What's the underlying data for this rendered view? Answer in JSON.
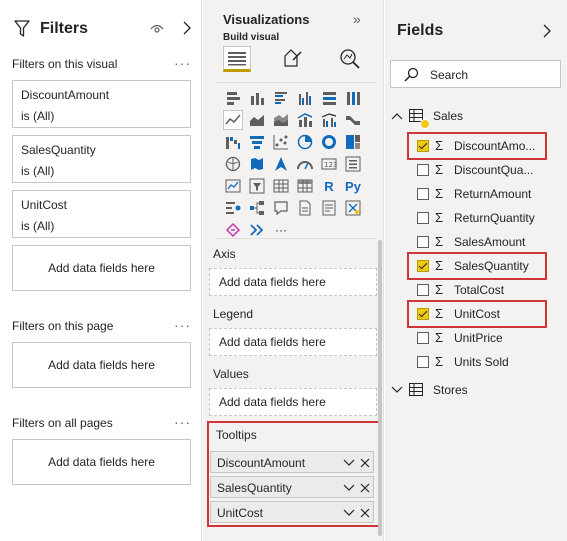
{
  "filters": {
    "title": "Filters",
    "visual_section": "Filters on this visual",
    "visual_cards": [
      {
        "name": "DiscountAmount",
        "state": "is (All)"
      },
      {
        "name": "SalesQuantity",
        "state": "is (All)"
      },
      {
        "name": "UnitCost",
        "state": "is (All)"
      }
    ],
    "add_label": "Add data fields here",
    "page_section": "Filters on this page",
    "all_section": "Filters on all pages",
    "more": "···"
  },
  "visualizations": {
    "title": "Visualizations",
    "collapse": "»",
    "build_label": "Build visual",
    "r_label": "R",
    "py_label": "Py",
    "ellipsis": "···",
    "wells": [
      {
        "label": "Axis",
        "drop": "Add data fields here"
      },
      {
        "label": "Legend",
        "drop": "Add data fields here"
      },
      {
        "label": "Values",
        "drop": "Add data fields here"
      }
    ],
    "tooltips": {
      "label": "Tooltips",
      "fields": [
        "DiscountAmount",
        "SalesQuantity",
        "UnitCost"
      ]
    }
  },
  "fields": {
    "title": "Fields",
    "search_placeholder": "Search",
    "sigma": "Σ",
    "tables": [
      {
        "name": "Sales",
        "expanded": true,
        "fields": [
          {
            "name": "DiscountAmo...",
            "checked": true
          },
          {
            "name": "DiscountQua...",
            "checked": false
          },
          {
            "name": "ReturnAmount",
            "checked": false
          },
          {
            "name": "ReturnQuantity",
            "checked": false
          },
          {
            "name": "SalesAmount",
            "checked": false
          },
          {
            "name": "SalesQuantity",
            "checked": true
          },
          {
            "name": "TotalCost",
            "checked": false
          },
          {
            "name": "UnitCost",
            "checked": true
          },
          {
            "name": "UnitPrice",
            "checked": false
          },
          {
            "name": "Units Sold",
            "checked": false
          }
        ]
      },
      {
        "name": "Stores",
        "expanded": false
      }
    ]
  },
  "colors": {
    "highlight": "#d13438",
    "check_yellow": "#f2c811",
    "pane_bg": "#f3f2f1"
  }
}
